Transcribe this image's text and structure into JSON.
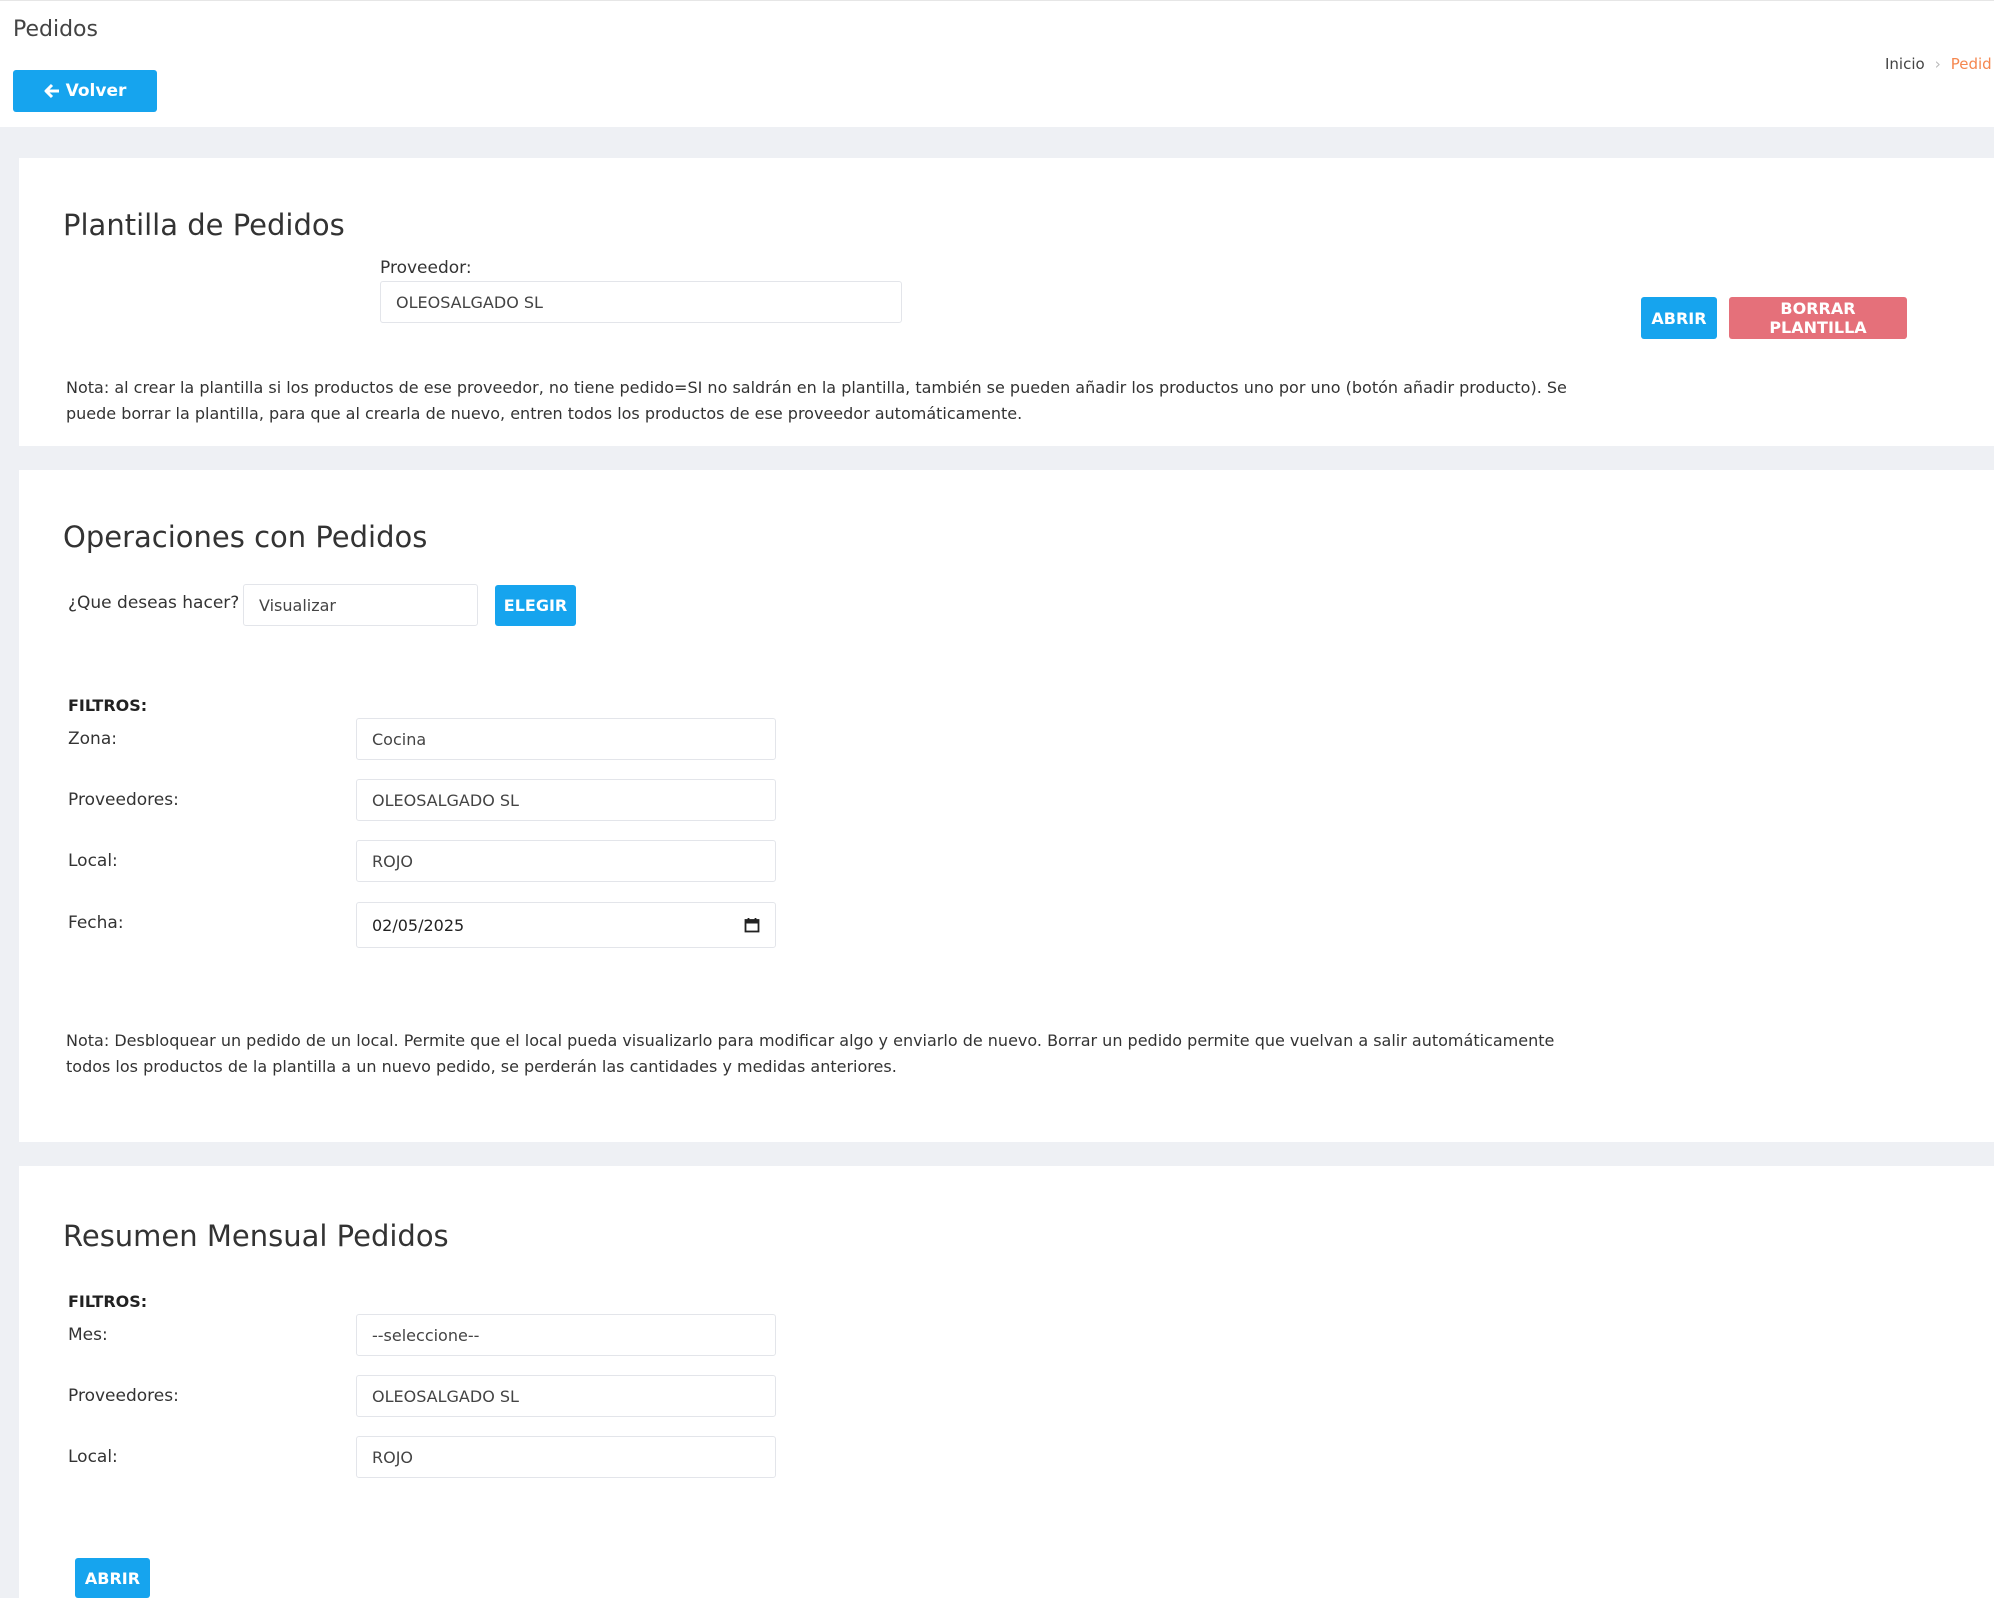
{
  "header": {
    "title": "Pedidos",
    "back_label": "Volver",
    "back_icon": "arrow-left-icon",
    "breadcrumb": {
      "home": "Inicio",
      "current": "Pedid"
    }
  },
  "template_section": {
    "title": "Plantilla de Pedidos",
    "supplier_label": "Proveedor:",
    "supplier_value": "OLEOSALGADO SL",
    "open_label": "ABRIR",
    "delete_label": "BORRAR PLANTILLA",
    "note_line1": "Nota: al crear la plantilla si los productos de ese proveedor, no tiene pedido=SI no saldrán en la plantilla, también se pueden añadir los productos uno por uno (botón añadir producto). Se",
    "note_line2": "puede borrar la plantilla, para que al crearla de nuevo, entren todos los productos de ese proveedor automáticamente."
  },
  "operations_section": {
    "title": "Operaciones con Pedidos",
    "question_label": "¿Que deseas hacer?",
    "action_value": "Visualizar",
    "choose_label": "ELEGIR",
    "filters_label": "FILTROS:",
    "zone_label": "Zona:",
    "zone_value": "Cocina",
    "suppliers_label": "Proveedores:",
    "suppliers_value": "OLEOSALGADO SL",
    "local_label": "Local:",
    "local_value": "ROJO",
    "date_label": "Fecha:",
    "date_value": "02/05/2025",
    "note_line1": "Nota: Desbloquear un pedido de un local. Permite que el local pueda visualizarlo para modificar algo y enviarlo de nuevo. Borrar un pedido permite que vuelvan a salir automáticamente",
    "note_line2": "todos los productos de la plantilla a un nuevo pedido, se perderán las cantidades y medidas anteriores."
  },
  "monthly_section": {
    "title": "Resumen Mensual Pedidos",
    "filters_label": "FILTROS:",
    "month_label": "Mes:",
    "month_value": "--seleccione--",
    "suppliers_label": "Proveedores:",
    "suppliers_value": "OLEOSALGADO SL",
    "local_label": "Local:",
    "local_value": "ROJO",
    "open_label": "ABRIR"
  },
  "colors": {
    "primary": "#16a4ee",
    "danger": "#e5707a",
    "breadcrumb_active": "#f5874f",
    "page_bg": "#eef0f4"
  }
}
